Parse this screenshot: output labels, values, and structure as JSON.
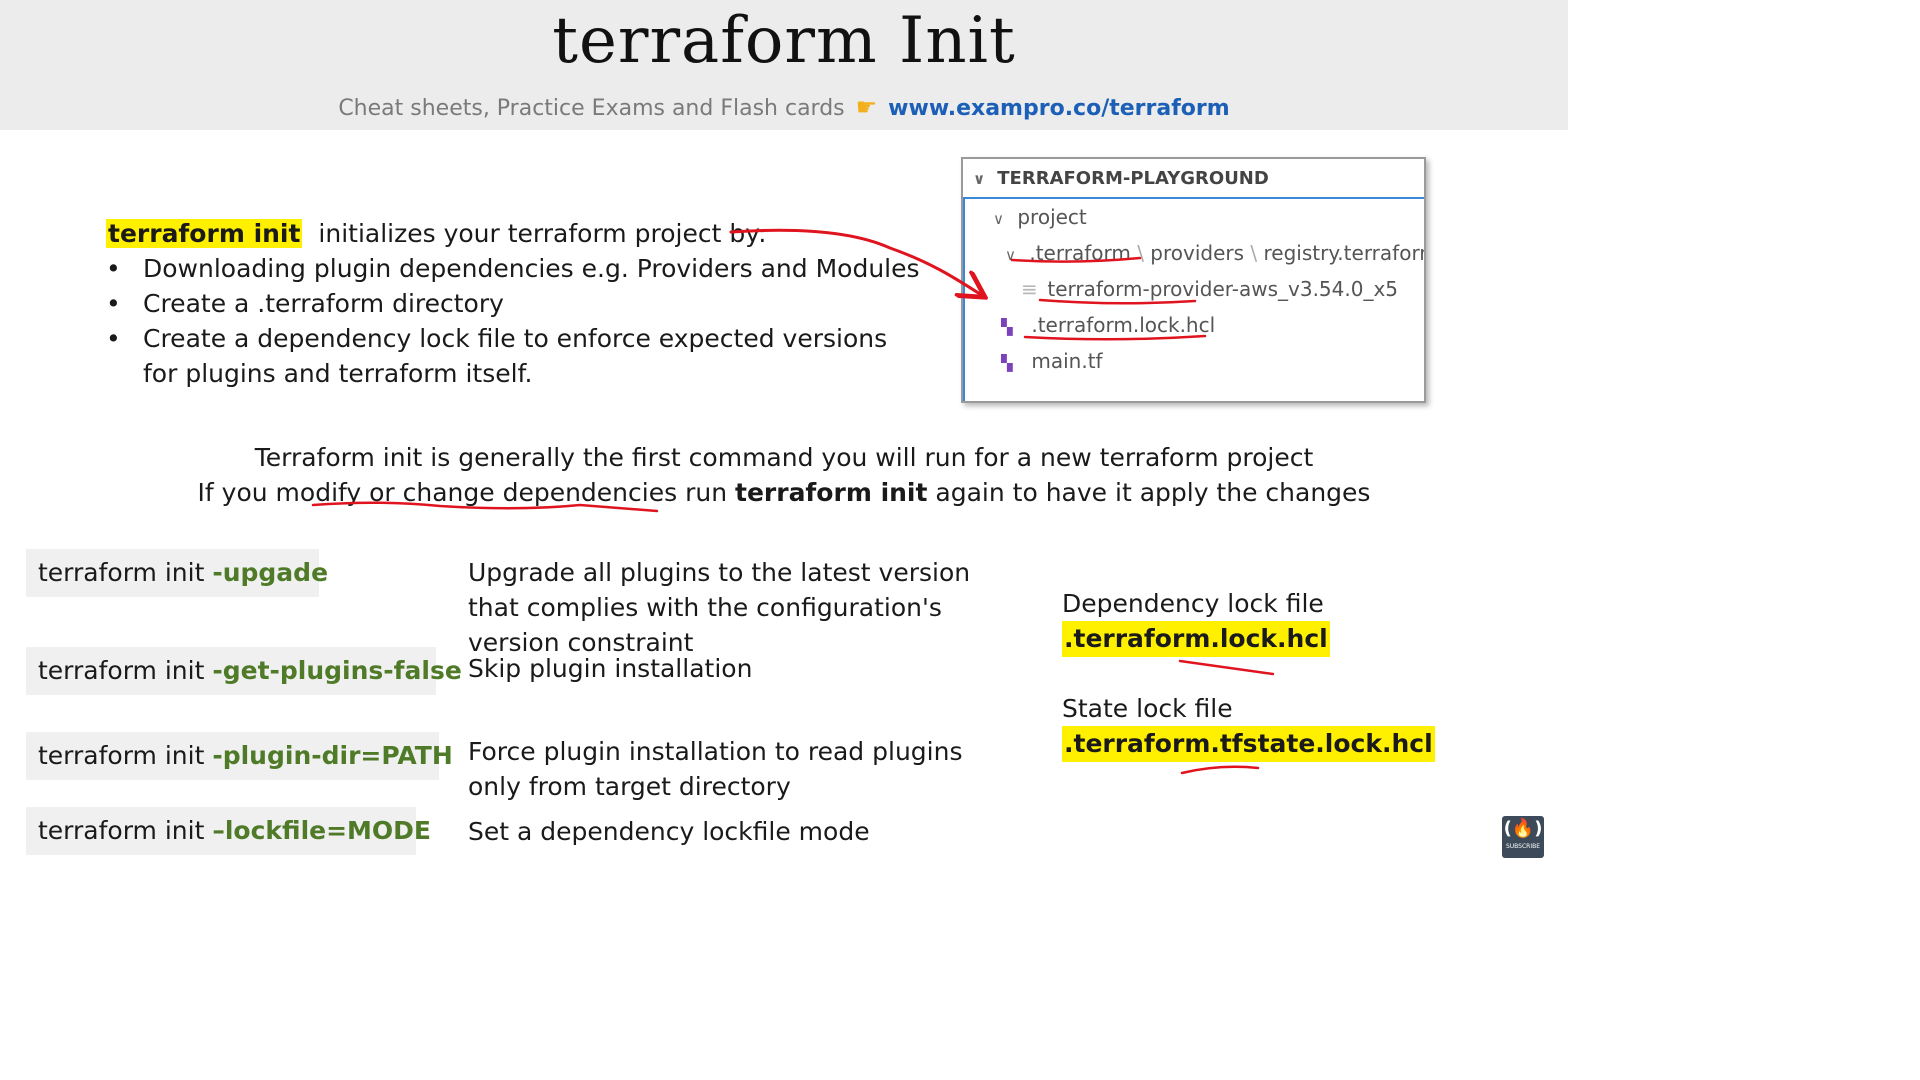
{
  "header": {
    "title": "terraform Init",
    "subtitle": "Cheat sheets, Practice Exams and Flash cards",
    "pointer_icon": "pointing-hand-icon",
    "link": "www.exampro.co/terraform"
  },
  "intro": {
    "command": "terraform init",
    "lead": "initializes your terraform project by:",
    "bullets": [
      "Downloading plugin dependencies e.g. Providers and Modules",
      "Create a .terraform directory",
      "Create a dependency lock file to enforce expected versions for plugins and terraform itself."
    ]
  },
  "explorer": {
    "header": "TERRAFORM-PLAYGROUND",
    "folder": "project",
    "path_parts": [
      ".terraform",
      "providers",
      "registry.terraform.io"
    ],
    "provider_file": "terraform-provider-aws_v3.54.0_x5",
    "lock_file": ".terraform.lock.hcl",
    "main_file": "main.tf"
  },
  "note": {
    "line1": "Terraform init is generally the first command you will run for a new terraform project",
    "line2_pre": "If you modify or change dependencies run ",
    "line2_bold": "terraform init",
    "line2_post": " again to have it apply the changes"
  },
  "options": [
    {
      "cmd": "terraform init ",
      "flag": "-upgade",
      "desc": "Upgrade all plugins to the latest version that complies with the configuration's version constraint"
    },
    {
      "cmd": "terraform init ",
      "flag": "-get-plugins-false",
      "desc": "Skip plugin installation"
    },
    {
      "cmd": "terraform init ",
      "flag": "-plugin-dir=PATH",
      "desc": "Force plugin installation to read plugins only from target directory"
    },
    {
      "cmd": "terraform init ",
      "flag": "–lockfile=MODE",
      "desc": "Set a dependency lockfile mode"
    }
  ],
  "locks": {
    "dependency_label": "Dependency lock file",
    "dependency_file": ".terraform.lock.hcl",
    "state_label": "State lock file",
    "state_file": ".terraform.tfstate.lock.hcl"
  },
  "badge": {
    "sub": "SUBSCRIBE"
  },
  "colors": {
    "highlight": "#fff000",
    "flag_green": "#4f7a28",
    "link_blue": "#1c5fb7",
    "annotation_red": "#e0141e",
    "terraform_purple": "#7b42bc"
  }
}
